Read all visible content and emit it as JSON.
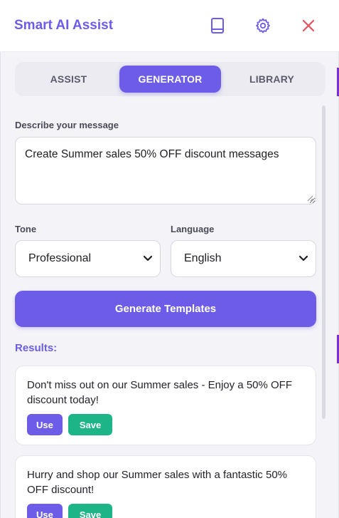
{
  "header": {
    "title": "Smart AI Assist",
    "icons": [
      "book-icon",
      "gear-icon",
      "close-icon"
    ]
  },
  "tabs": [
    {
      "label": "ASSIST",
      "active": false
    },
    {
      "label": "GENERATOR",
      "active": true
    },
    {
      "label": "LIBRARY",
      "active": false
    }
  ],
  "form": {
    "describe_label": "Describe your message",
    "message_value": "Create Summer sales 50% OFF discount messages",
    "tone_label": "Tone",
    "tone_value": "Professional",
    "language_label": "Language",
    "language_value": "English",
    "generate_label": "Generate Templates"
  },
  "results": {
    "title": "Results:",
    "items": [
      {
        "text": "Don't miss out on our Summer sales - Enjoy a 50% OFF discount today!",
        "use_label": "Use",
        "save_label": "Save"
      },
      {
        "text": "Hurry and shop our Summer sales with a fantastic 50% OFF discount!",
        "use_label": "Use",
        "save_label": "Save"
      }
    ]
  },
  "colors": {
    "accent": "#6c5ce7",
    "save": "#1db488",
    "close": "#e8505b"
  }
}
